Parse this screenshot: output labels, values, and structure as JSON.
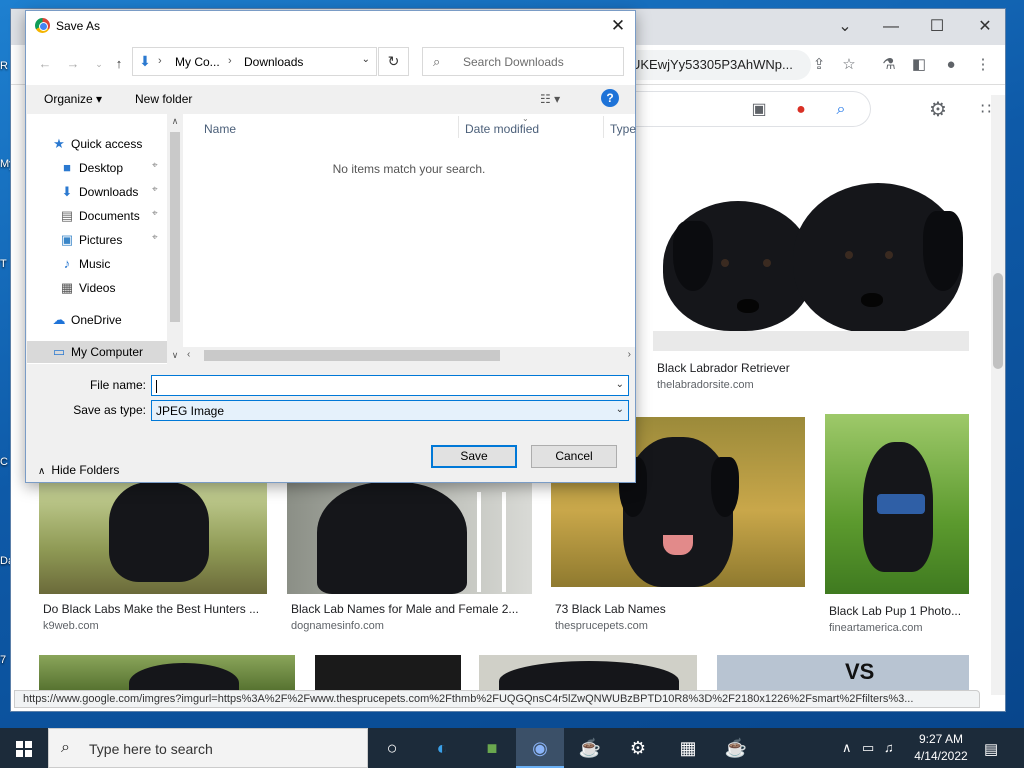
{
  "desktop": {
    "icon_labels": [
      "R",
      "My",
      "T",
      "C",
      "Da",
      "7"
    ]
  },
  "browser": {
    "url_fragment": "UKEwjYy53305P3AhWNp...",
    "controls": {
      "minimize": "—",
      "maximize": "☐",
      "close": "✕",
      "collapse": "⌄"
    },
    "status_url": "https://www.google.com/imgres?imgurl=https%3A%2F%2Fwww.thesprucepets.com%2Fthmb%2FUQGQnsC4r5lZwQNWUBzBPTD10R8%3D%2F2180x1226%2Fsmart%2Ffilters%3...",
    "results": [
      {
        "caption": "Black Labrador Retriever",
        "source": "thelabradorsite.com"
      },
      {
        "caption": "Do Black Labs Make the Best Hunters ...",
        "source": "k9web.com"
      },
      {
        "caption": "Black Lab Names for Male and Female 2...",
        "source": "dognamesinfo.com"
      },
      {
        "caption": "73 Black Lab Names",
        "source": "thesprucepets.com"
      },
      {
        "caption": "Black Lab Pup 1 Photo...",
        "source": "fineartamerica.com"
      }
    ],
    "overlay_text": "VS"
  },
  "dialog": {
    "title": "Save As",
    "address": {
      "crumbs": [
        "My Co...",
        "Downloads"
      ],
      "separator": "›"
    },
    "search_placeholder": "Search Downloads",
    "commands": {
      "organize": "Organize ▾",
      "new_folder": "New folder",
      "view": "☷ ▾",
      "help": "?"
    },
    "nav_items": [
      {
        "label": "Quick access",
        "icon": "star-icon",
        "glyph": "★",
        "color": "#2b79d0",
        "pinned": false
      },
      {
        "label": "Desktop",
        "icon": "desktop-folder-icon",
        "glyph": "■",
        "color": "#2b79d0",
        "pinned": true
      },
      {
        "label": "Downloads",
        "icon": "download-arrow-icon",
        "glyph": "⬇",
        "color": "#2b79d0",
        "pinned": true
      },
      {
        "label": "Documents",
        "icon": "documents-icon",
        "glyph": "▤",
        "color": "#666666",
        "pinned": true
      },
      {
        "label": "Pictures",
        "icon": "pictures-icon",
        "glyph": "▣",
        "color": "#3a86c8",
        "pinned": true
      },
      {
        "label": "Music",
        "icon": "music-icon",
        "glyph": "♪",
        "color": "#2b79d0",
        "pinned": false
      },
      {
        "label": "Videos",
        "icon": "videos-icon",
        "glyph": "▦",
        "color": "#555555",
        "pinned": false
      },
      {
        "label": "OneDrive",
        "icon": "onedrive-cloud-icon",
        "glyph": "☁",
        "color": "#1e73d8",
        "pinned": false
      },
      {
        "label": "My Computer",
        "icon": "computer-icon",
        "glyph": "▭",
        "color": "#2b79d0",
        "pinned": false
      }
    ],
    "columns": [
      "Name",
      "Date modified",
      "Type"
    ],
    "empty_message": "No items match your search.",
    "file_name_label": "File name:",
    "file_name_value": "",
    "save_type_label": "Save as type:",
    "save_type_value": "JPEG Image",
    "hide_folders": "Hide Folders",
    "save_button": "Save",
    "cancel_button": "Cancel"
  },
  "taskbar": {
    "search_placeholder": "Type here to search",
    "time": "9:27 AM",
    "date": "4/14/2022"
  },
  "colors": {
    "accent": "#0078d7",
    "taskbar": "#1c2b3a",
    "desktop": "#0e5aa8"
  }
}
